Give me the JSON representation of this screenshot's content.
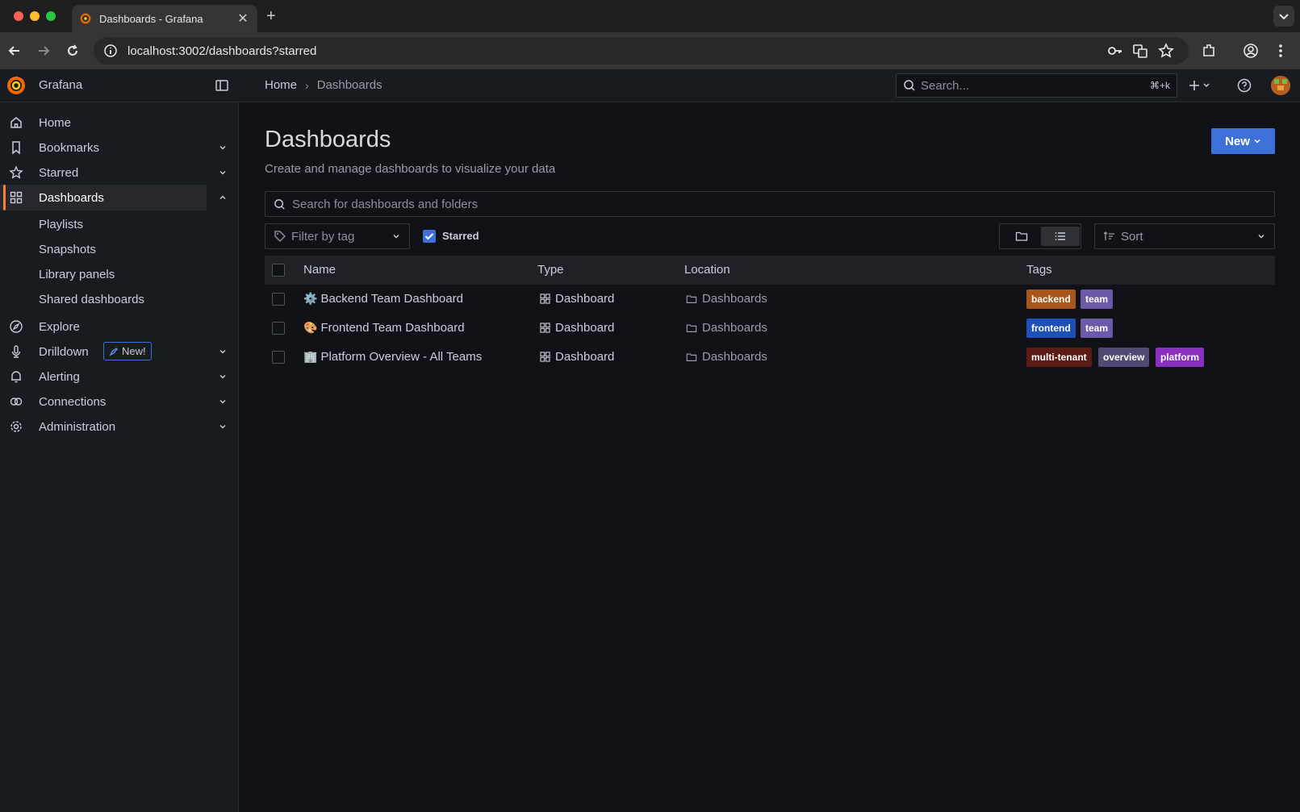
{
  "browser": {
    "tab_title": "Dashboards - Grafana",
    "url": "localhost:3002/dashboards?starred"
  },
  "app": {
    "name": "Grafana"
  },
  "breadcrumb": {
    "home": "Home",
    "current": "Dashboards"
  },
  "topbar": {
    "search_placeholder": "Search...",
    "search_shortcut": "⌘+k"
  },
  "sidebar": {
    "items": [
      {
        "label": "Home",
        "icon": "home-icon"
      },
      {
        "label": "Bookmarks",
        "icon": "bookmark-icon"
      },
      {
        "label": "Starred",
        "icon": "star-icon"
      },
      {
        "label": "Dashboards",
        "icon": "apps-icon"
      },
      {
        "label": "Explore",
        "icon": "compass-icon"
      },
      {
        "label": "Drilldown",
        "icon": "microphone-icon",
        "badge": "New!"
      },
      {
        "label": "Alerting",
        "icon": "bell-icon"
      },
      {
        "label": "Connections",
        "icon": "link-icon"
      },
      {
        "label": "Administration",
        "icon": "cog-icon"
      }
    ],
    "dashboards_children": [
      "Playlists",
      "Snapshots",
      "Library panels",
      "Shared dashboards"
    ]
  },
  "page": {
    "title": "Dashboards",
    "subtitle": "Create and manage dashboards to visualize your data",
    "new_button": "New",
    "search_placeholder": "Search for dashboards and folders",
    "tag_filter_placeholder": "Filter by tag",
    "starred_label": "Starred",
    "starred_checked": true,
    "sort_placeholder": "Sort"
  },
  "table": {
    "columns": [
      "Name",
      "Type",
      "Location",
      "Tags"
    ],
    "rows": [
      {
        "emoji": "⚙️",
        "name": "Backend Team Dashboard",
        "type": "Dashboard",
        "location": "Dashboards",
        "tags": [
          {
            "label": "backend",
            "color": "#a8561b"
          },
          {
            "label": "team",
            "color": "#6b5aa8"
          }
        ]
      },
      {
        "emoji": "🎨",
        "name": "Frontend Team Dashboard",
        "type": "Dashboard",
        "location": "Dashboards",
        "tags": [
          {
            "label": "frontend",
            "color": "#1f4fb8"
          },
          {
            "label": "team",
            "color": "#6b5aa8"
          }
        ]
      },
      {
        "emoji": "🏢",
        "name": "Platform Overview - All Teams",
        "type": "Dashboard",
        "location": "Dashboards",
        "tags": [
          {
            "label": "multi-tenant",
            "color": "#5c1c16"
          },
          {
            "label": "overview",
            "color": "#4e4a73"
          },
          {
            "label": "platform",
            "color": "#8a2fc0"
          }
        ]
      }
    ]
  },
  "colors": {
    "accent": "#ff7a34",
    "primary": "#3d71d9",
    "background": "#111217"
  }
}
